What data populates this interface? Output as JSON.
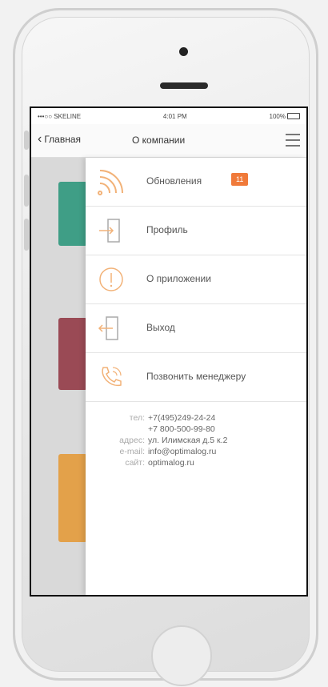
{
  "status_bar": {
    "carrier": "•••○○ SKELINE",
    "time": "4:01 PM",
    "battery": "100%"
  },
  "nav": {
    "back_label": "Главная",
    "title": "О компании"
  },
  "menu": [
    {
      "label": "Обновления",
      "icon": "rss-feed-icon",
      "badge": "11"
    },
    {
      "label": "Профиль",
      "icon": "login-door-icon"
    },
    {
      "label": "О приложении",
      "icon": "info-icon"
    },
    {
      "label": "Выход",
      "icon": "logout-door-icon"
    },
    {
      "label": "Позвонить менеджеру",
      "icon": "phone-call-icon"
    }
  ],
  "contacts": {
    "phone_label": "тел:",
    "phones": [
      "+7(495)249-24-24",
      "+7 800-500-99-80"
    ],
    "address_label": "адрес:",
    "address": "ул. Илимская д.5 к.2",
    "email_label": "e-mail:",
    "email": "info@optimalog.ru",
    "site_label": "сайт:",
    "site": "optimalog.ru"
  },
  "colors": {
    "accent": "#f07a3a",
    "icon": "#f2b278",
    "card_green": "#3f9e86",
    "card_red": "#9a4a55",
    "card_orange": "#e3a14a"
  }
}
